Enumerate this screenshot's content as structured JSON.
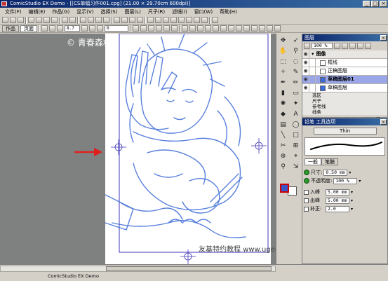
{
  "window": {
    "title": "ComicStudio EX Demo - [[CS单幅习作001.cpg] (21.00 × 29.70cm 600dpi)]"
  },
  "menu": [
    "文件(F)",
    "编辑(E)",
    "作品(G)",
    "显示(V)",
    "选择(S)",
    "图层(L)",
    "尺子(R)",
    "滤镜(I)",
    "窗口(W)",
    "帮助(H)"
  ],
  "tabs": {
    "story": "作品",
    "page": "页面"
  },
  "toolbar": {
    "rotation": "8.7",
    "zoom": "0"
  },
  "canvas": {
    "copyright": "© 青春森林 · 友基科技",
    "watermark": "友基特约教程 www.ugee.com.cn"
  },
  "layers_panel": {
    "title": "图层",
    "opacity": "100 %",
    "layers": [
      {
        "name": "图像",
        "type": "folder",
        "selected": false
      },
      {
        "name": "框线",
        "type": "layer",
        "selected": false
      },
      {
        "name": "正稿图层",
        "type": "layer",
        "selected": false
      },
      {
        "name": "草稿图层01",
        "type": "layer",
        "selected": true
      },
      {
        "name": "草稿图层",
        "type": "layer",
        "selected": false
      }
    ],
    "groups": [
      "选区",
      "尺子",
      "参考线",
      "线条"
    ],
    "info": "光栅图层 600 dpi黑白(2bit)草稿设置"
  },
  "tool_options": {
    "title": "铅笔 工具选项",
    "brush_name": "Thin",
    "tabs": [
      "一般",
      "笔触"
    ],
    "size_label": "尺寸:",
    "size_value": "0.50 mm",
    "opacity_label": "不透明度:",
    "opacity_value": "100 %",
    "in_label": "入峰",
    "in_value": "5.00 mm",
    "out_label": "出峰",
    "out_value": "5.00 mm",
    "correction_label": "补正:",
    "correction_value": "2.0"
  },
  "status": {
    "text": "ComicStudio EX Demo"
  },
  "colors": {
    "titlebar": "#0a246a",
    "workspace": "#7f8181",
    "sketch": "#3c6ad8",
    "layer_selected": "#9aa6e8"
  }
}
